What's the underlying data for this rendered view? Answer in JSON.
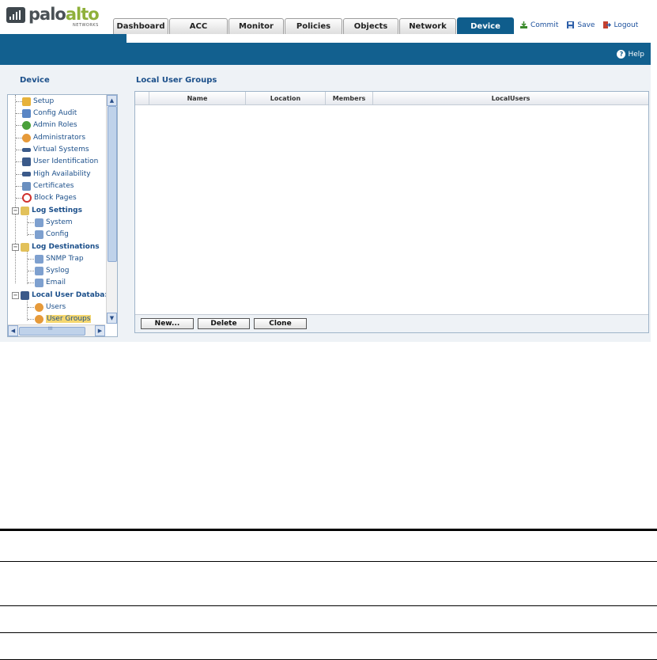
{
  "brand": {
    "name_part1": "palo",
    "name_part2": "alto",
    "tagline": "NETWORKS"
  },
  "tabs": [
    "Dashboard",
    "ACC",
    "Monitor",
    "Policies",
    "Objects",
    "Network",
    "Device"
  ],
  "active_tab": "Device",
  "toplinks": {
    "commit": "Commit",
    "save": "Save",
    "logout": "Logout"
  },
  "help_label": "Help",
  "sidebar": {
    "title": "Device",
    "items": [
      {
        "label": "Setup",
        "icon": "setup-icon"
      },
      {
        "label": "Config Audit",
        "icon": "config-audit-icon"
      },
      {
        "label": "Admin Roles",
        "icon": "admin-roles-icon"
      },
      {
        "label": "Administrators",
        "icon": "administrators-icon"
      },
      {
        "label": "Virtual Systems",
        "icon": "virtual-systems-icon"
      },
      {
        "label": "User Identification",
        "icon": "user-identification-icon"
      },
      {
        "label": "High Availability",
        "icon": "high-availability-icon"
      },
      {
        "label": "Certificates",
        "icon": "certificates-icon"
      },
      {
        "label": "Block Pages",
        "icon": "block-pages-icon"
      },
      {
        "label": "Log Settings",
        "icon": "log-settings-icon"
      },
      {
        "label": "System",
        "icon": "log-system-icon"
      },
      {
        "label": "Config",
        "icon": "log-config-icon"
      },
      {
        "label": "Log Destinations",
        "icon": "log-destinations-icon"
      },
      {
        "label": "SNMP Trap",
        "icon": "snmp-trap-icon"
      },
      {
        "label": "Syslog",
        "icon": "syslog-icon"
      },
      {
        "label": "Email",
        "icon": "email-icon"
      },
      {
        "label": "Local User Databa:",
        "icon": "local-user-database-icon"
      },
      {
        "label": "Users",
        "icon": "users-icon"
      },
      {
        "label": "User Groups",
        "icon": "user-groups-icon"
      }
    ],
    "selected": "User Groups",
    "hscroll_label": "III"
  },
  "main": {
    "title": "Local User Groups",
    "columns": [
      "Name",
      "Location",
      "Members",
      "LocalUsers"
    ],
    "rows": [],
    "buttons": {
      "new": "New...",
      "delete": "Delete",
      "clone": "Clone"
    }
  },
  "colors": {
    "brand_blue": "#12608f",
    "logo_green": "#8fb03a",
    "link_blue": "#1b4f8a",
    "selection": "#f5d770"
  }
}
